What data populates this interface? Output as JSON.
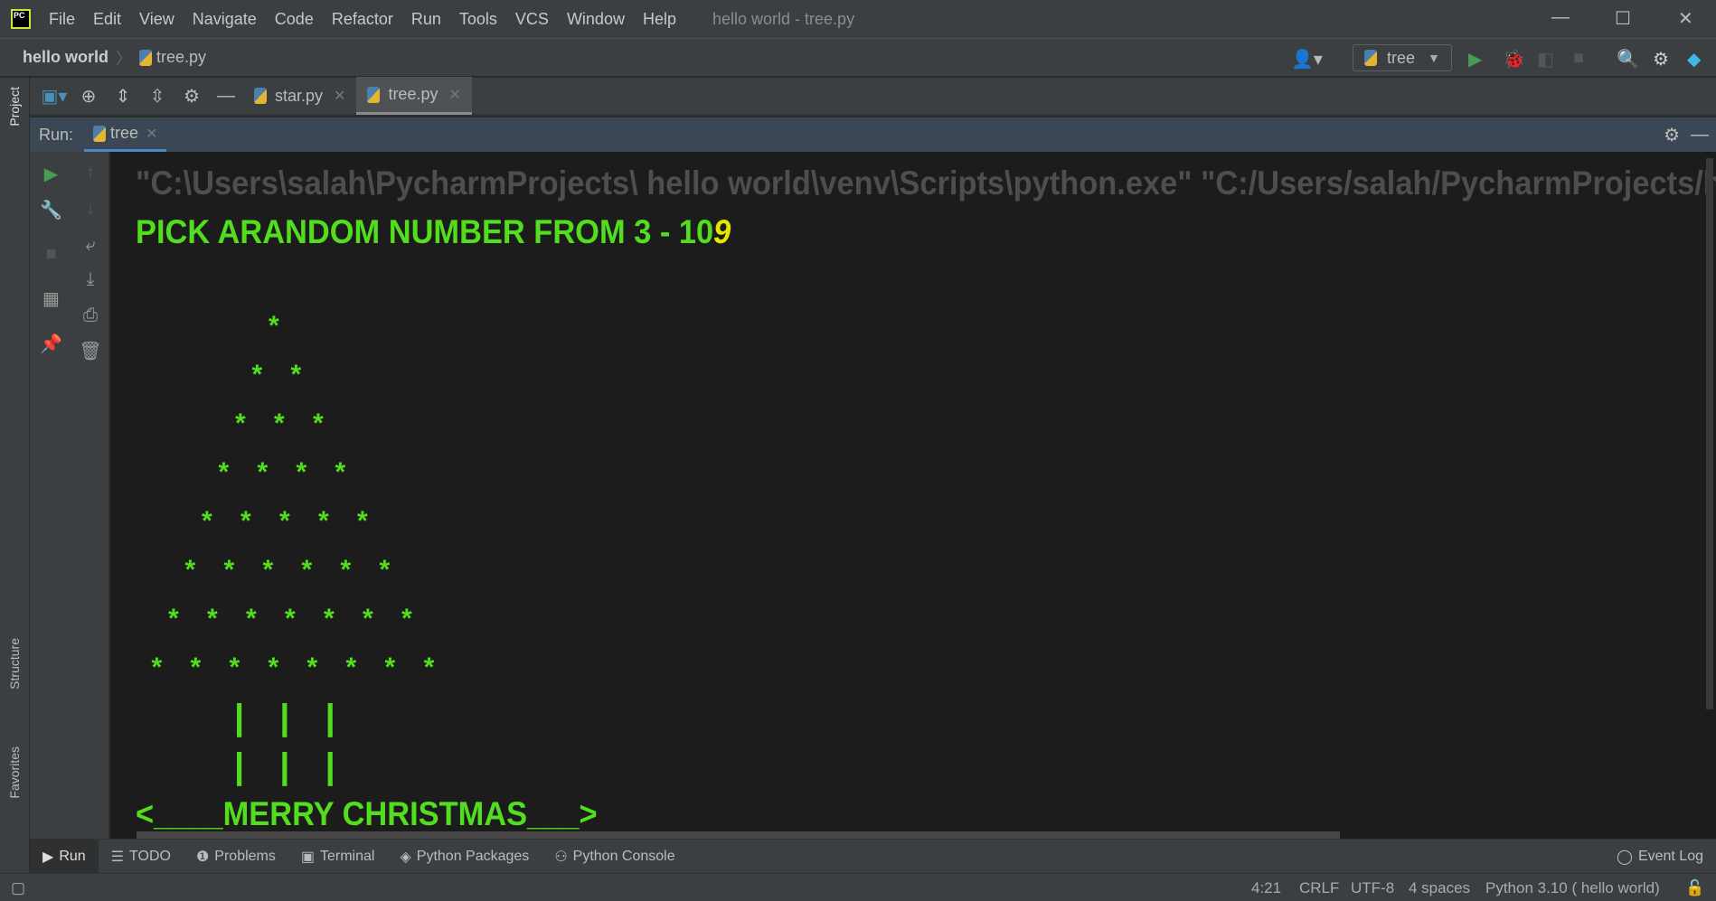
{
  "app": {
    "logo": "PC",
    "window_title": "hello world - tree.py"
  },
  "menu": [
    "File",
    "Edit",
    "View",
    "Navigate",
    "Code",
    "Refactor",
    "Run",
    "Tools",
    "VCS",
    "Window",
    "Help"
  ],
  "nav": {
    "project": "hello world",
    "file": "tree.py",
    "run_config": "tree"
  },
  "side": {
    "project": "Project",
    "structure": "Structure",
    "favorites": "Favorites"
  },
  "file_tabs": [
    {
      "label": "star.py",
      "active": false
    },
    {
      "label": "tree.py",
      "active": true
    }
  ],
  "run": {
    "label": "Run:",
    "tab": "tree"
  },
  "console": {
    "command": "\"C:\\Users\\salah\\PycharmProjects\\ hello world\\venv\\Scripts\\python.exe\" \"C:/Users/salah/PycharmProjects/hello world/tree.py\"",
    "prompt": "PICK ARANDOM NUMBER FROM 3 - 10",
    "input": "9",
    "tree_rows": [
      "*",
      "* *",
      "* * *",
      "* * * *",
      "* * * * *",
      "* * * * * *",
      "* * * * * * *",
      "* * * * * * * *"
    ],
    "trunk_rows": [
      "| | |",
      "| | |"
    ],
    "greeting": "<____MERRY CHRISTMAS___>"
  },
  "bottom_tabs": [
    "Run",
    "TODO",
    "Problems",
    "Terminal",
    "Python Packages",
    "Python Console"
  ],
  "event_log": "Event Log",
  "status": {
    "position": "4:21",
    "line_sep": "CRLF",
    "encoding": "UTF-8",
    "indent": "4 spaces",
    "interpreter": "Python 3.10 ( hello world)"
  },
  "colors": {
    "output": "#52dd1e",
    "input": "#e6e600",
    "command": "#4e4e4e"
  }
}
